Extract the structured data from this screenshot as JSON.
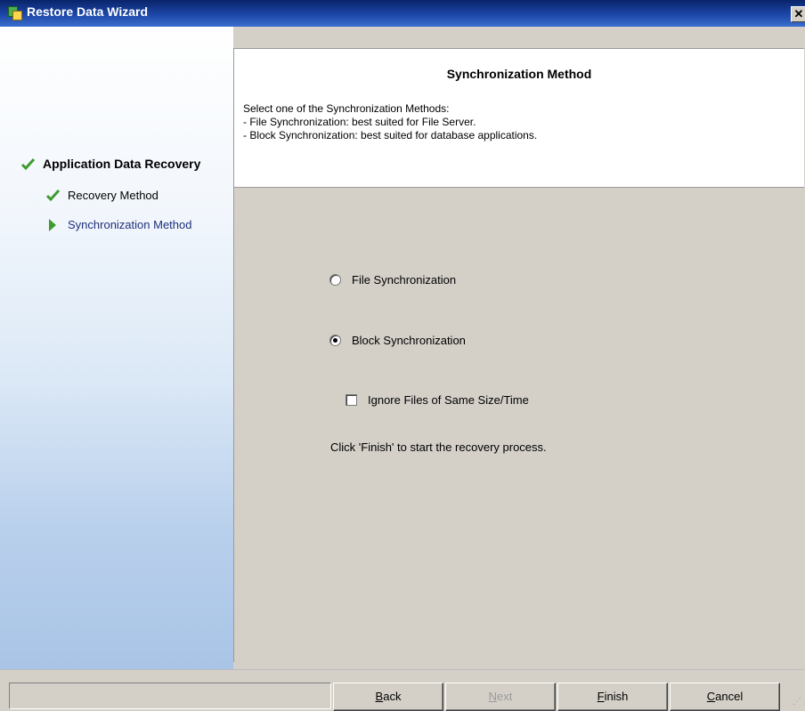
{
  "window": {
    "title": "Restore Data Wizard",
    "close_glyph": "✕"
  },
  "sidebar": {
    "main_item": {
      "label": "Application Data Recovery",
      "icon": "check-icon"
    },
    "sub_items": [
      {
        "label": "Recovery Method",
        "icon": "check-icon"
      },
      {
        "label": "Synchronization Method",
        "icon": "arrow-right-icon"
      }
    ]
  },
  "header": {
    "title": "Synchronization Method",
    "description": [
      "Select one of the Synchronization Methods:",
      "- File Synchronization: best suited for File Server.",
      "- Block Synchronization: best suited for database applications."
    ]
  },
  "options": {
    "file_sync": {
      "label": "File Synchronization",
      "selected": false
    },
    "block_sync": {
      "label": "Block Synchronization",
      "selected": true
    },
    "ignore_files": {
      "label": "Ignore Files of Same Size/Time",
      "checked": false
    },
    "finish_hint": "Click 'Finish' to start the recovery process."
  },
  "buttons": {
    "back": "Back",
    "next": "Next",
    "finish": "Finish",
    "cancel": "Cancel"
  },
  "colors": {
    "accent_check": "#3f9b2c",
    "active_nav_text": "#1f2f7a",
    "titlebar": "#0a246a"
  }
}
